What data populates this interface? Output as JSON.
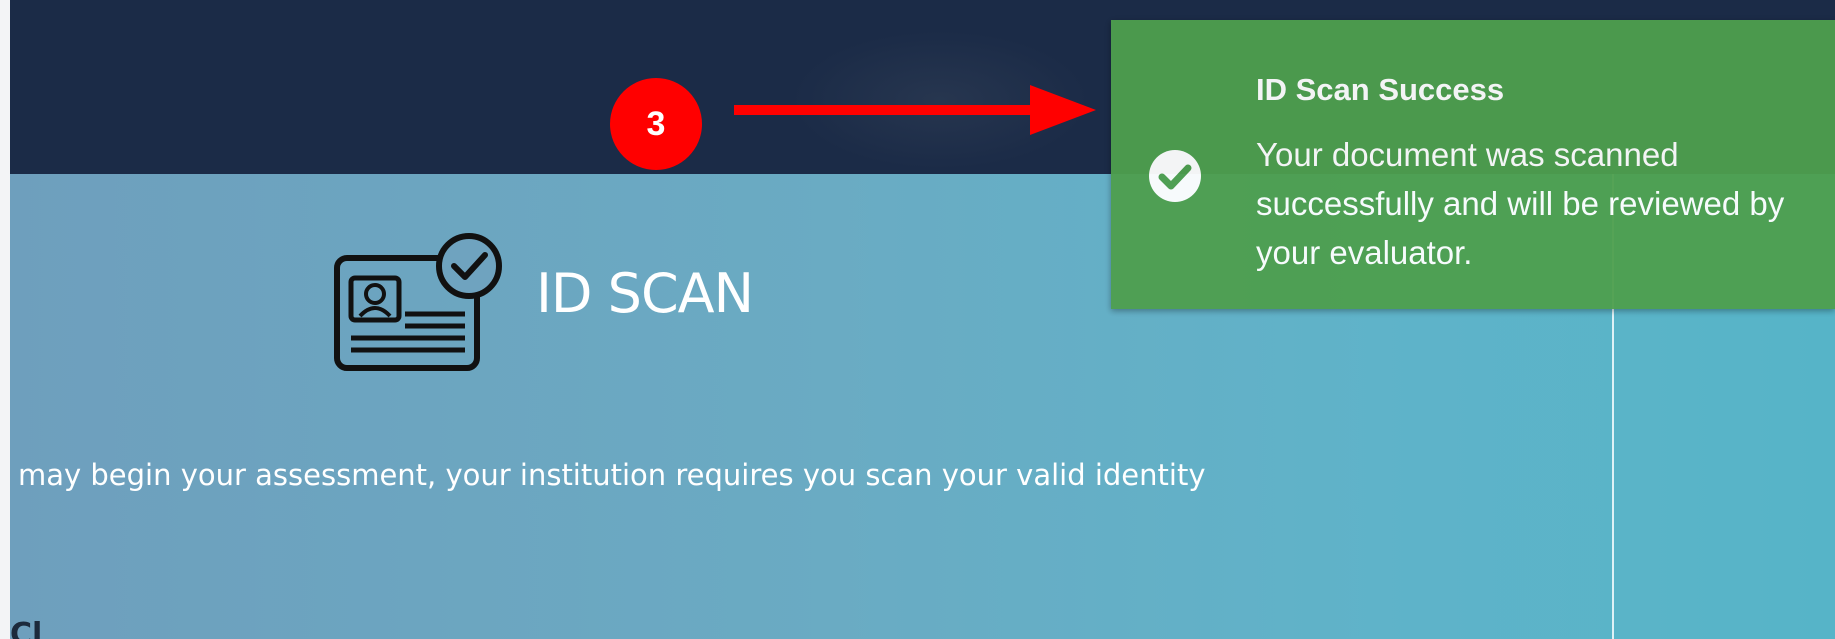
{
  "colors": {
    "header_bg": "#1b2b47",
    "main_gradient_start": "#6e9fbd",
    "main_gradient_end": "#56b4c8",
    "toast_bg": "#4e9f4e",
    "annotation_red": "#ff0000"
  },
  "page": {
    "title": "ID SCAN",
    "icon": "id-card-check-icon",
    "instructions": "may begin your assessment, your institution requires you scan your valid identity",
    "cut_text": "Cl"
  },
  "annotation": {
    "step_number": "3",
    "arrow_icon": "arrow-right-icon"
  },
  "toast": {
    "icon": "check-circle-icon",
    "title": "ID Scan Success",
    "message": "Your document was scanned successfully and will be reviewed by your evaluator."
  }
}
